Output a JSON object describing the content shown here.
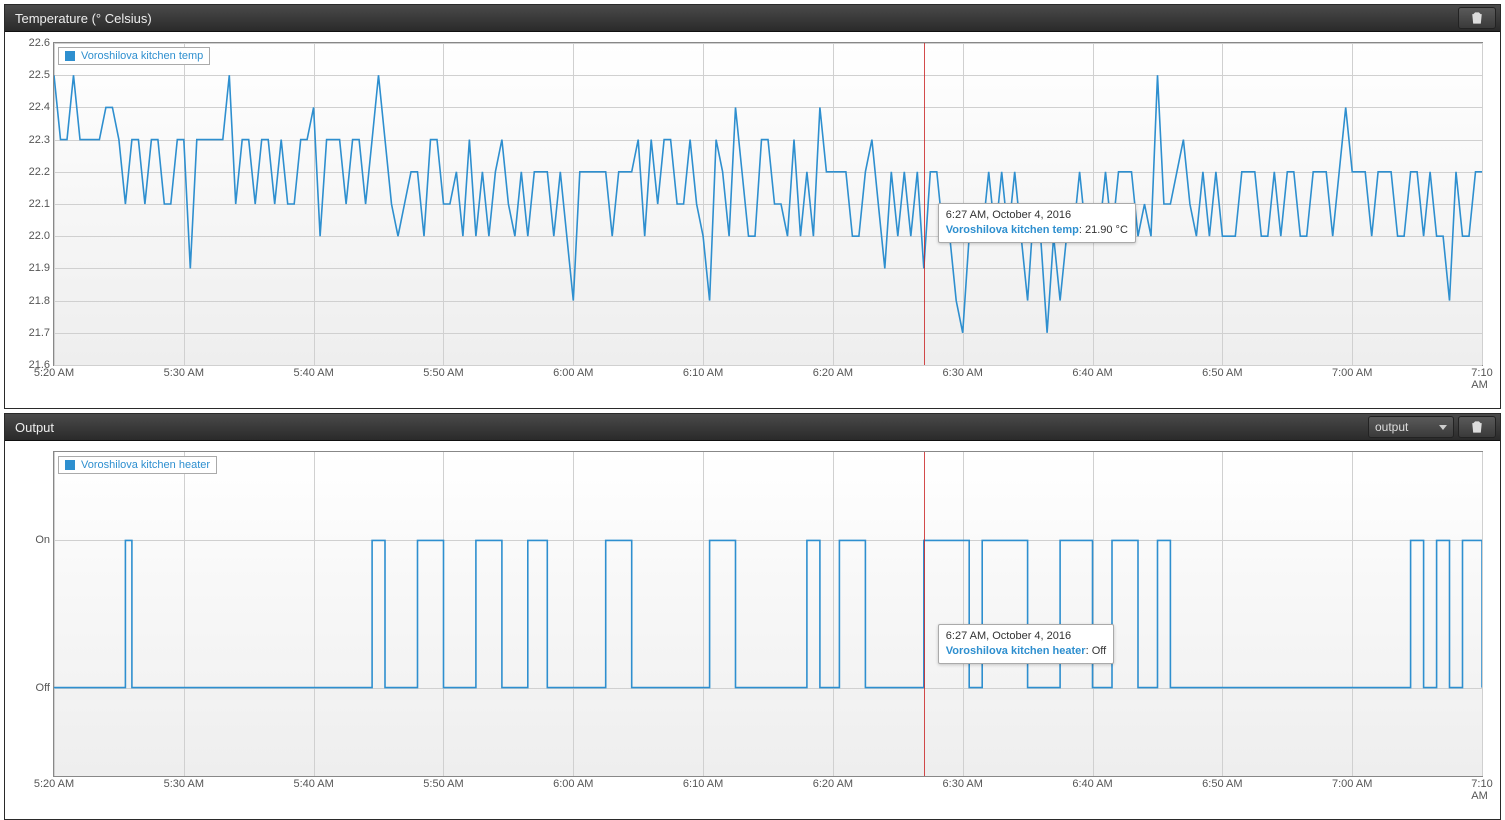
{
  "panels": {
    "temp": {
      "title": "Temperature (° Celsius)",
      "legend": "Voroshilova kitchen temp",
      "tooltip": {
        "time": "6:27 AM, October 4, 2016",
        "series": "Voroshilova kitchen temp",
        "value": "21.90 °C"
      }
    },
    "output": {
      "title": "Output",
      "select_label": "output",
      "legend": "Voroshilova kitchen heater",
      "tooltip": {
        "time": "6:27 AM, October 4, 2016",
        "series": "Voroshilova kitchen heater",
        "value": "Off"
      }
    }
  },
  "chart_data": [
    {
      "type": "line",
      "title": "Temperature (° Celsius)",
      "series_name": "Voroshilova kitchen temp",
      "x_unit": "time (AM, Oct 4 2016)",
      "y_unit": "°C",
      "ylim": [
        21.6,
        22.6
      ],
      "xlim_minutes": [
        320,
        430
      ],
      "x_ticks": [
        "5:20 AM",
        "5:30 AM",
        "5:40 AM",
        "5:50 AM",
        "6:00 AM",
        "6:10 AM",
        "6:20 AM",
        "6:30 AM",
        "6:40 AM",
        "6:50 AM",
        "7:00 AM",
        "7:10 AM"
      ],
      "y_ticks": [
        21.6,
        21.7,
        21.8,
        21.9,
        22.0,
        22.1,
        22.2,
        22.3,
        22.4,
        22.5,
        22.6
      ],
      "crosshair_minute": 387,
      "crosshair_value": 21.9,
      "x_minutes": [
        320.0,
        320.5,
        321.0,
        321.5,
        322.0,
        322.5,
        323.0,
        323.5,
        324.0,
        324.5,
        325.0,
        325.5,
        326.0,
        326.5,
        327.0,
        327.5,
        328.0,
        328.5,
        329.0,
        329.5,
        330.0,
        330.5,
        331.0,
        331.5,
        332.0,
        332.5,
        333.0,
        333.5,
        334.0,
        334.5,
        335.0,
        335.5,
        336.0,
        336.5,
        337.0,
        337.5,
        338.0,
        338.5,
        339.0,
        339.5,
        340.0,
        340.5,
        341.0,
        341.5,
        342.0,
        342.5,
        343.0,
        343.5,
        344.0,
        344.5,
        345.0,
        345.5,
        346.0,
        346.5,
        347.0,
        347.5,
        348.0,
        348.5,
        349.0,
        349.5,
        350.0,
        350.5,
        351.0,
        351.5,
        352.0,
        352.5,
        353.0,
        353.5,
        354.0,
        354.5,
        355.0,
        355.5,
        356.0,
        356.5,
        357.0,
        357.5,
        358.0,
        358.5,
        359.0,
        359.5,
        360.0,
        360.5,
        361.0,
        361.5,
        362.0,
        362.5,
        363.0,
        363.5,
        364.0,
        364.5,
        365.0,
        365.5,
        366.0,
        366.5,
        367.0,
        367.5,
        368.0,
        368.5,
        369.0,
        369.5,
        370.0,
        370.5,
        371.0,
        371.5,
        372.0,
        372.5,
        373.0,
        373.5,
        374.0,
        374.5,
        375.0,
        375.5,
        376.0,
        376.5,
        377.0,
        377.5,
        378.0,
        378.5,
        379.0,
        379.5,
        380.0,
        380.5,
        381.0,
        381.5,
        382.0,
        382.5,
        383.0,
        383.5,
        384.0,
        384.5,
        385.0,
        385.5,
        386.0,
        386.5,
        387.0,
        387.5,
        388.0,
        388.5,
        389.0,
        389.5,
        390.0,
        390.5,
        391.0,
        391.5,
        392.0,
        392.5,
        393.0,
        393.5,
        394.0,
        394.5,
        395.0,
        395.5,
        396.0,
        396.5,
        397.0,
        397.5,
        398.0,
        398.5,
        399.0,
        399.5,
        400.0,
        400.5,
        401.0,
        401.5,
        402.0,
        402.5,
        403.0,
        403.5,
        404.0,
        404.5,
        405.0,
        405.5,
        406.0,
        406.5,
        407.0,
        407.5,
        408.0,
        408.5,
        409.0,
        409.5,
        410.0,
        410.5,
        411.0,
        411.5,
        412.0,
        412.5,
        413.0,
        413.5,
        414.0,
        414.5,
        415.0,
        415.5,
        416.0,
        416.5,
        417.0,
        417.5,
        418.0,
        418.5,
        419.0,
        419.5,
        420.0,
        420.5,
        421.0,
        421.5,
        422.0,
        422.5,
        423.0,
        423.5,
        424.0,
        424.5,
        425.0,
        425.5,
        426.0,
        426.5,
        427.0,
        427.5,
        428.0,
        428.5,
        429.0,
        429.5,
        430.0
      ],
      "y": [
        22.5,
        22.3,
        22.3,
        22.5,
        22.3,
        22.3,
        22.3,
        22.3,
        22.4,
        22.4,
        22.3,
        22.1,
        22.3,
        22.3,
        22.1,
        22.3,
        22.3,
        22.1,
        22.1,
        22.3,
        22.3,
        21.9,
        22.3,
        22.3,
        22.3,
        22.3,
        22.3,
        22.5,
        22.1,
        22.3,
        22.3,
        22.1,
        22.3,
        22.3,
        22.1,
        22.3,
        22.1,
        22.1,
        22.3,
        22.3,
        22.4,
        22.0,
        22.3,
        22.3,
        22.3,
        22.1,
        22.3,
        22.3,
        22.1,
        22.3,
        22.5,
        22.3,
        22.1,
        22.0,
        22.1,
        22.2,
        22.2,
        22.0,
        22.3,
        22.3,
        22.1,
        22.1,
        22.2,
        22.0,
        22.3,
        22.0,
        22.2,
        22.0,
        22.2,
        22.3,
        22.1,
        22.0,
        22.2,
        22.0,
        22.2,
        22.2,
        22.2,
        22.0,
        22.2,
        22.0,
        21.8,
        22.2,
        22.2,
        22.2,
        22.2,
        22.2,
        22.0,
        22.2,
        22.2,
        22.2,
        22.3,
        22.0,
        22.3,
        22.1,
        22.3,
        22.3,
        22.1,
        22.1,
        22.3,
        22.1,
        22.0,
        21.8,
        22.3,
        22.2,
        22.0,
        22.4,
        22.2,
        22.0,
        22.0,
        22.3,
        22.3,
        22.1,
        22.1,
        22.0,
        22.3,
        22.0,
        22.2,
        22.0,
        22.4,
        22.2,
        22.2,
        22.2,
        22.2,
        22.0,
        22.0,
        22.2,
        22.3,
        22.1,
        21.9,
        22.2,
        22.0,
        22.2,
        22.0,
        22.2,
        21.9,
        22.2,
        22.2,
        22.0,
        22.0,
        21.8,
        21.7,
        22.0,
        22.0,
        22.0,
        22.2,
        22.0,
        22.2,
        22.0,
        22.2,
        22.0,
        21.8,
        22.1,
        22.0,
        21.7,
        22.0,
        21.8,
        22.0,
        22.0,
        22.2,
        22.0,
        22.1,
        22.0,
        22.2,
        22.0,
        22.2,
        22.2,
        22.2,
        22.0,
        22.1,
        22.0,
        22.5,
        22.1,
        22.1,
        22.2,
        22.3,
        22.1,
        22.0,
        22.2,
        22.0,
        22.2,
        22.0,
        22.0,
        22.0,
        22.2,
        22.2,
        22.2,
        22.0,
        22.0,
        22.2,
        22.0,
        22.2,
        22.2,
        22.0,
        22.0,
        22.2,
        22.2,
        22.2,
        22.0,
        22.2,
        22.4,
        22.2,
        22.2,
        22.2,
        22.0,
        22.2,
        22.2,
        22.2,
        22.0,
        22.0,
        22.2,
        22.2,
        22.0,
        22.2,
        22.0,
        22.0,
        21.8,
        22.2,
        22.0,
        22.0,
        22.2,
        22.2
      ]
    },
    {
      "type": "step",
      "title": "Output",
      "series_name": "Voroshilova kitchen heater",
      "y_categories": [
        "Off",
        "On"
      ],
      "ylim": [
        -0.6,
        1.6
      ],
      "xlim_minutes": [
        320,
        430
      ],
      "x_ticks": [
        "5:20 AM",
        "5:30 AM",
        "5:40 AM",
        "5:50 AM",
        "6:00 AM",
        "6:10 AM",
        "6:20 AM",
        "6:30 AM",
        "6:40 AM",
        "6:50 AM",
        "7:00 AM",
        "7:10 AM"
      ],
      "crosshair_minute": 387,
      "crosshair_value": "Off",
      "on_intervals_minutes": [
        [
          325.5,
          326.0
        ],
        [
          344.5,
          345.5
        ],
        [
          348.0,
          350.0
        ],
        [
          352.5,
          354.5
        ],
        [
          356.5,
          358.0
        ],
        [
          362.5,
          364.5
        ],
        [
          370.5,
          372.5
        ],
        [
          378.0,
          379.0
        ],
        [
          380.5,
          382.5
        ],
        [
          387.0,
          390.5
        ],
        [
          391.5,
          395.0
        ],
        [
          397.5,
          400.0
        ],
        [
          401.5,
          403.5
        ],
        [
          405.0,
          406.0
        ],
        [
          424.5,
          425.5
        ],
        [
          426.5,
          427.5
        ],
        [
          428.5,
          431.0
        ]
      ]
    }
  ]
}
